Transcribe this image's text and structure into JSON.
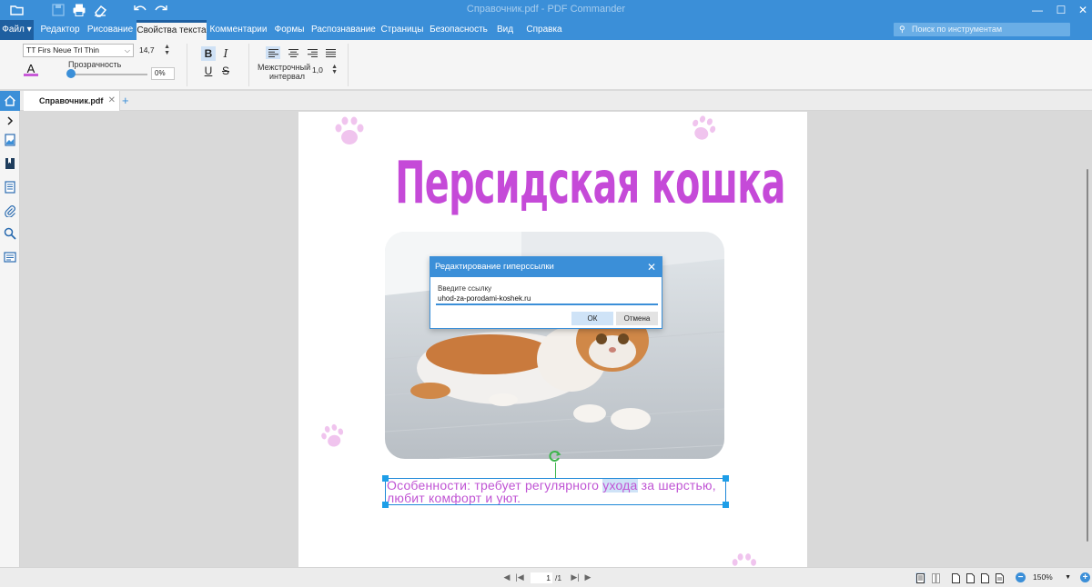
{
  "window": {
    "title": "Справочник.pdf - PDF Commander",
    "controls": {
      "minimize": "—",
      "maximize": "☐",
      "close": "✕"
    }
  },
  "menu": {
    "file_label": "Файл",
    "tabs": [
      "Редактор",
      "Рисование",
      "Свойства текста",
      "Комментарии",
      "Формы",
      "Распознавание",
      "Страницы",
      "Безопасность",
      "Вид",
      "Справка"
    ],
    "active_tab": "Свойства текста",
    "search_placeholder": "Поиск по инструментам"
  },
  "ribbon": {
    "font_family": "TT Firs Neue Trl Thin",
    "font_size": "14,7",
    "color_letter": "A",
    "text_color": "#c85ad8",
    "opacity_label": "Прозрачность",
    "opacity_value": "0%",
    "opacity_level": 0,
    "bold": "B",
    "italic": "I",
    "underline": "U",
    "strike": "S",
    "line_spacing_label_1": "Межстрочный",
    "line_spacing_label_2": "интервал",
    "line_spacing_value": "1,0"
  },
  "tabs": {
    "doc_tab_label": "Справочник.pdf",
    "close": "✕",
    "add": "+"
  },
  "document": {
    "title": "Персидская кошка",
    "body_before": "Особенности: требует регулярного ",
    "body_highlight": "ухода",
    "body_after": " за шерстью, любит комфорт и уют.",
    "title_color": "#c54ad8"
  },
  "dialog": {
    "title": "Редактирование гиперссылки",
    "close": "✕",
    "label": "Введите ссылку",
    "value": "uhod-za-porodami-koshek.ru",
    "ok": "ОК",
    "cancel": "Отмена"
  },
  "status": {
    "current_page": "1",
    "total_pages": "/1",
    "zoom": "150%"
  }
}
